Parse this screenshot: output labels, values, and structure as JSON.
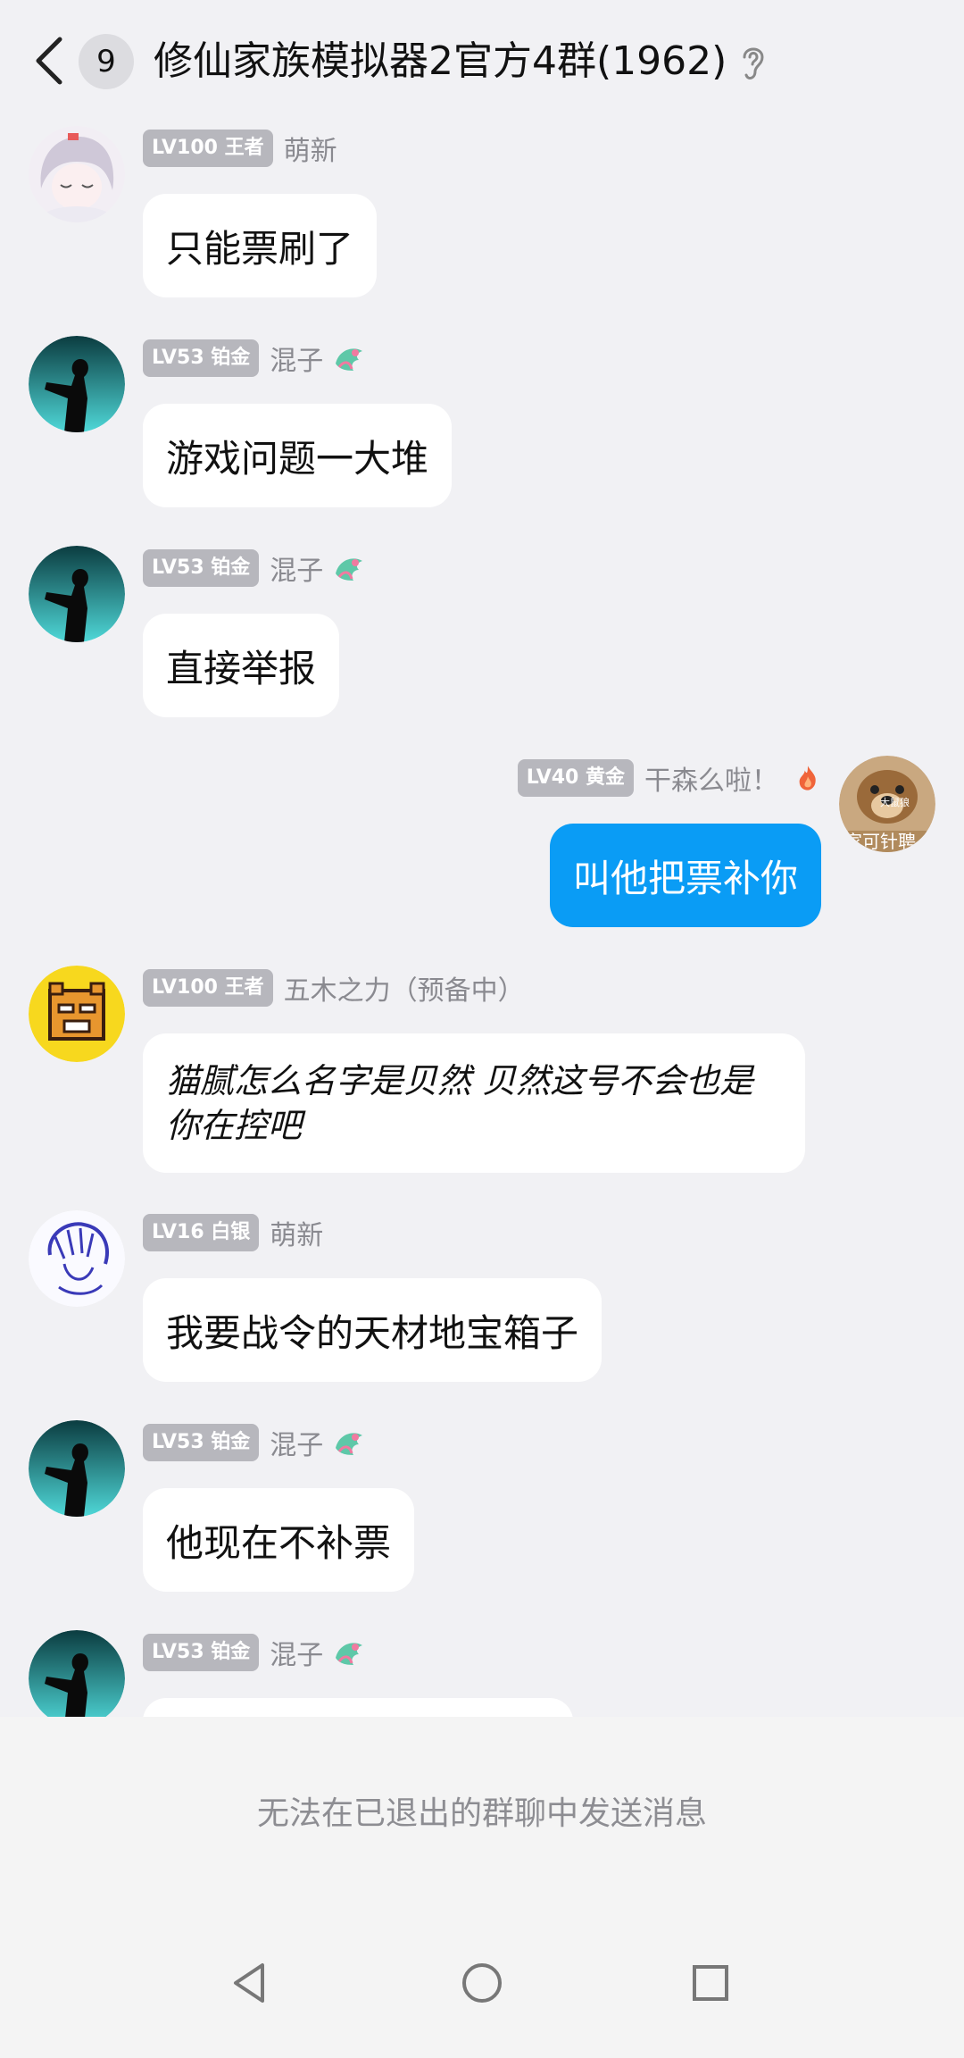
{
  "header": {
    "unread_count": "9",
    "title": "修仙家族模拟器2官方4群(1962)"
  },
  "messages": [
    {
      "level": "LV100 王者",
      "nickname": "萌新",
      "text": "只能票刷了",
      "side": "left"
    },
    {
      "level": "LV53 铂金",
      "nickname": "混子",
      "text": "游戏问题一大堆",
      "side": "left"
    },
    {
      "level": "LV53 铂金",
      "nickname": "混子",
      "text": "直接举报",
      "side": "left"
    },
    {
      "level": "LV40 黄金",
      "nickname": "干森么啦！",
      "text": "叫他把票补你",
      "side": "right"
    },
    {
      "level": "LV100 王者",
      "nickname": "五木之力（预备中）",
      "text": "猫腻怎么名字是贝然  贝然这号不会也是你在控吧",
      "side": "left"
    },
    {
      "level": "LV16 白银",
      "nickname": "萌新",
      "text": "我要战令的天材地宝箱子",
      "side": "left"
    },
    {
      "level": "LV53 铂金",
      "nickname": "混子",
      "text": "他现在不补票",
      "side": "left"
    },
    {
      "level": "LV53 铂金",
      "nickname": "混子",
      "text": "",
      "side": "left"
    }
  ],
  "avatar_texts": {
    "bear_top": "大鼠狼",
    "bear_bottom": "家可针聘"
  },
  "composer": {
    "disabled_text": "无法在已退出的群聊中发送消息"
  },
  "colors": {
    "background": "#f1f1f4",
    "my_bubble": "#0a9cf5",
    "level_badge": "#b7b7bd"
  },
  "icons": {
    "back": "chevron-left-icon",
    "ear": "ear-icon",
    "dragon": "dragon-title-icon",
    "fire": "fire-title-icon",
    "nav_back": "triangle-back-icon",
    "nav_home": "circle-home-icon",
    "nav_recents": "square-recents-icon"
  }
}
